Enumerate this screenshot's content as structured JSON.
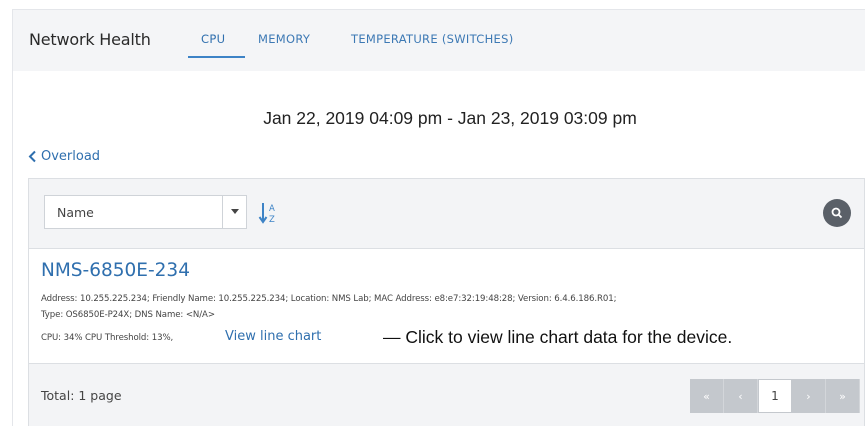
{
  "header": {
    "title": "Network Health",
    "tabs": [
      {
        "label": "CPU",
        "active": true
      },
      {
        "label": "MEMORY",
        "active": false
      },
      {
        "label": "TEMPERATURE (SWITCHES)",
        "active": false
      }
    ]
  },
  "date_range": "Jan 22, 2019 04:09 pm - Jan 23, 2019 03:09 pm",
  "back_link": {
    "label": "Overload",
    "icon": "chevron-left-icon"
  },
  "toolbar": {
    "sort_field": "Name",
    "sort_icon": "sort-alpha-ascending-icon",
    "search_icon": "search-icon"
  },
  "device": {
    "name": "NMS-6850E-234",
    "line1": "Address: 10.255.225.234; Friendly Name: 10.255.225.234; Location: NMS Lab; MAC Address: e8:e7:32:19:48:28; Version: 6.4.6.186.R01;",
    "line2": "Type: OS6850E-P24X; DNS Name: <N/A>",
    "line3": "CPU: 34% CPU Threshold: 13%,",
    "view_line_chart": "View line chart",
    "callout": "— Click to view line chart data for the device."
  },
  "footer": {
    "total": "Total: 1 page",
    "pager": {
      "first": "«",
      "prev": "‹",
      "current": "1",
      "next": "›",
      "last": "»"
    }
  },
  "colors": {
    "accent": "#2f6fae",
    "header_bg": "#f4f5f7",
    "pager_bg": "#c4c8cd",
    "search_bg": "#5a6068"
  }
}
